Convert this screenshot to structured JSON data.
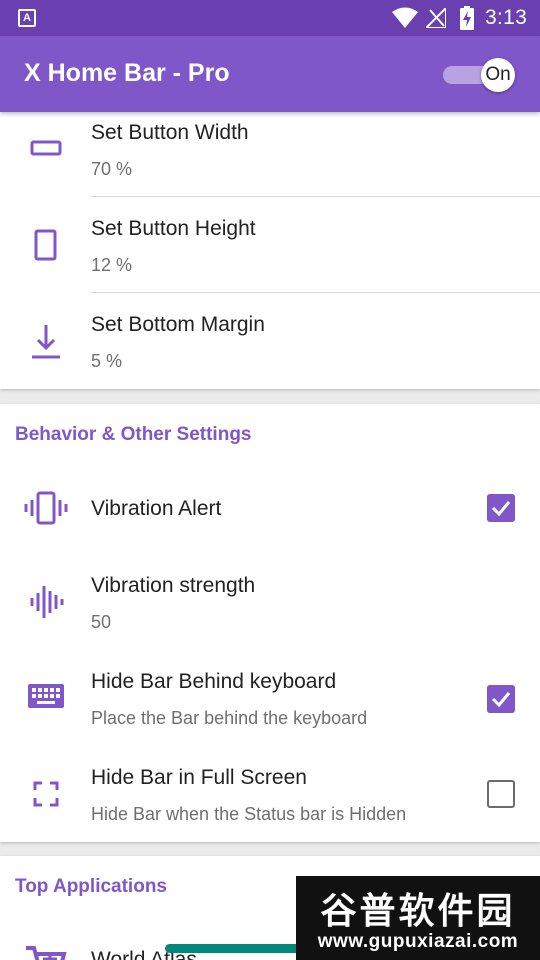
{
  "status_bar": {
    "notification_glyph": "A",
    "time": "3:13",
    "icons": [
      "wifi-icon",
      "no-signal-icon",
      "battery-charging-icon"
    ]
  },
  "app_bar": {
    "title": "X Home Bar - Pro",
    "toggle_label": "On",
    "toggle_on": true
  },
  "colors": {
    "status_bar": "#6a3fb0",
    "app_bar": "#8057c8",
    "accent": "#8057c8",
    "scrollbar": "#00897b"
  },
  "size_settings": [
    {
      "title": "Set Button Width",
      "value": "70 %",
      "icon": "width-rectangle-icon"
    },
    {
      "title": "Set Button Height",
      "value": "12 %",
      "icon": "height-rectangle-icon"
    },
    {
      "title": "Set Bottom Margin",
      "value": "5 %",
      "icon": "bottom-margin-icon"
    }
  ],
  "behavior_section": {
    "header": "Behavior & Other Settings",
    "items": [
      {
        "title": "Vibration Alert",
        "checked": true,
        "icon": "vibration-icon"
      },
      {
        "title": "Vibration strength",
        "value": "50",
        "icon": "sound-wave-icon"
      },
      {
        "title": "Hide Bar Behind keyboard",
        "summary": "Place the Bar behind the keyboard",
        "checked": true,
        "icon": "keyboard-icon"
      },
      {
        "title": "Hide Bar in Full Screen",
        "summary": "Hide Bar when the Status bar is Hidden",
        "checked": false,
        "icon": "fullscreen-icon"
      }
    ]
  },
  "top_apps_section": {
    "header": "Top Applications",
    "items": [
      {
        "title": "World Atlas",
        "icon": "cart-app-icon"
      }
    ]
  },
  "watermark": {
    "line1": "谷普软件园",
    "line2": "www.gupuxiazai.com"
  }
}
